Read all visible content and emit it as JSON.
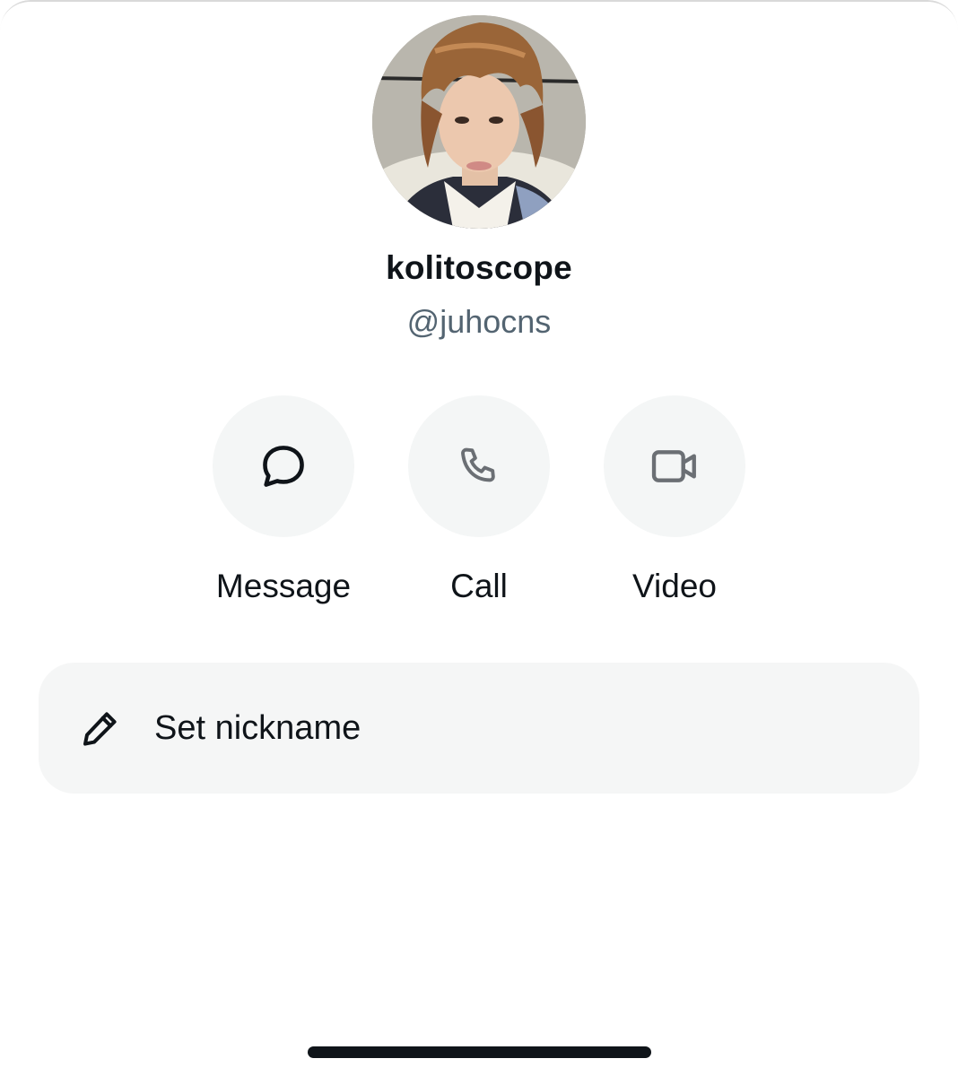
{
  "profile": {
    "display_name": "kolitoscope",
    "handle": "@juhocns",
    "avatar": "avatar-photo"
  },
  "actions": [
    {
      "label": "Message",
      "icon": "message-bubble-icon"
    },
    {
      "label": "Call",
      "icon": "phone-icon"
    },
    {
      "label": "Video",
      "icon": "video-camera-icon"
    }
  ],
  "nickname": {
    "label": "Set nickname",
    "icon": "pencil-icon"
  },
  "colors": {
    "text_primary": "#0f1419",
    "text_secondary": "#536471",
    "button_bg": "#f4f6f6"
  }
}
